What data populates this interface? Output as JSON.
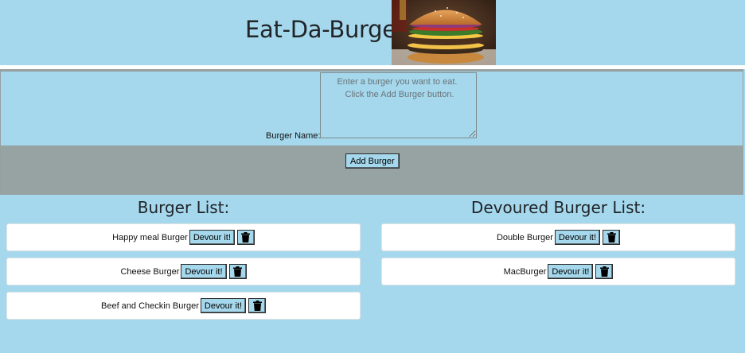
{
  "header": {
    "title": "Eat-Da-Burger!",
    "image_alt": "burger-photo"
  },
  "form": {
    "label": "Burger Name:",
    "placeholder": "Enter a burger you want to eat. \n Click the Add Burger button.",
    "value": "",
    "submit_label": "Add Burger"
  },
  "burger_list": {
    "title": "Burger List:",
    "items": [
      {
        "name": "Happy meal Burger",
        "action": "Devour it!"
      },
      {
        "name": "Cheese Burger",
        "action": "Devour it!"
      },
      {
        "name": "Beef and Checkin Burger",
        "action": "Devour it!"
      }
    ]
  },
  "devoured_list": {
    "title": "Devoured Burger List:",
    "items": [
      {
        "name": "Double Burger",
        "action": "Devour it!"
      },
      {
        "name": "MacBurger",
        "action": "Devour it!"
      }
    ]
  },
  "icons": {
    "delete": "trash-icon"
  },
  "colors": {
    "background": "#a5d8ec",
    "form_band": "#96a3a2",
    "card": "#ffffff",
    "button": "#a5d8ec"
  }
}
